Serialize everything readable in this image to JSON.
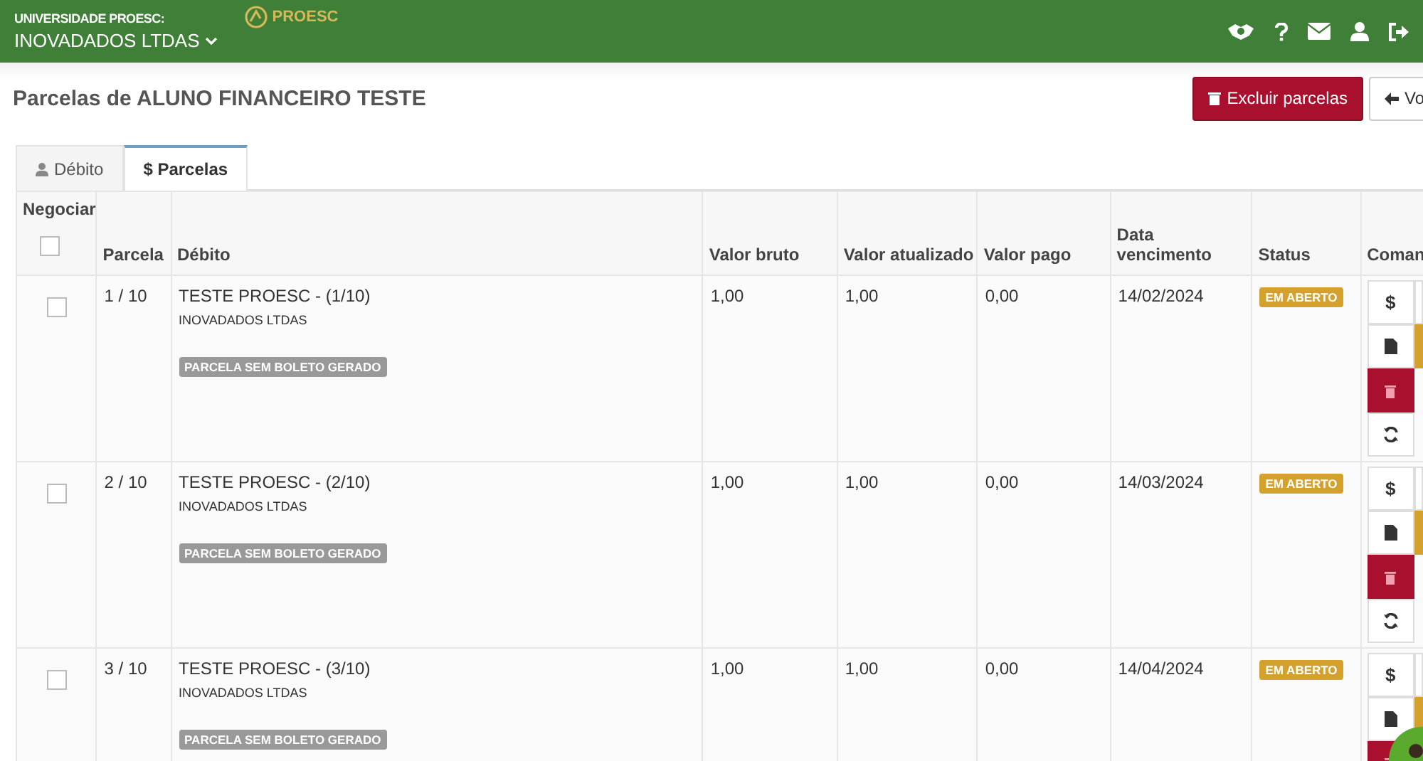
{
  "header": {
    "org_label": "UNIVERSIDADE PROESC:",
    "company": "INOVADADOS LTDAS",
    "logo_text": "PROESC"
  },
  "page": {
    "title": "Parcelas de ALUNO FINANCEIRO TESTE",
    "buttons": [
      {
        "kind": "danger",
        "label": "Excluir parcelas"
      },
      {
        "kind": "back",
        "label": "Vo"
      }
    ]
  },
  "tabs": [
    {
      "label": "Débito",
      "selected": false
    },
    {
      "label": "$ Parcelas",
      "selected": true
    }
  ],
  "table": {
    "columns": [
      "Negociar",
      "Parcela",
      "Débito",
      "Valor bruto",
      "Valor atualizado",
      "Valor pago",
      "Data vencimento",
      "Status",
      "Coman"
    ],
    "header_checked": false,
    "pay_symbols": [
      "$",
      "$",
      "$"
    ],
    "rows": [
      {
        "checked": false,
        "parcela": "1 / 10",
        "debito": "TESTE PROESC - (1/10)",
        "empresa": "INOVADADOS LTDAS",
        "badge": "PARCELA SEM BOLETO GERADO",
        "valor_bruto": "1,00",
        "valor_atualizado": "1,00",
        "valor_pago": "0,00",
        "vencimento": "14/02/2024",
        "status": "EM ABERTO"
      },
      {
        "checked": false,
        "parcela": "2 / 10",
        "debito": "TESTE PROESC - (2/10)",
        "empresa": "INOVADADOS LTDAS",
        "badge": "PARCELA SEM BOLETO GERADO",
        "valor_bruto": "1,00",
        "valor_atualizado": "1,00",
        "valor_pago": "0,00",
        "vencimento": "14/03/2024",
        "status": "EM ABERTO"
      },
      {
        "checked": false,
        "parcela": "3 / 10",
        "debito": "TESTE PROESC - (3/10)",
        "empresa": "INOVADADOS LTDAS",
        "badge": "PARCELA SEM BOLETO GERADO",
        "valor_bruto": "1,00",
        "valor_atualizado": "1,00",
        "valor_pago": "0,00",
        "vencimento": "14/04/2024",
        "status": "EM ABERTO"
      }
    ]
  }
}
